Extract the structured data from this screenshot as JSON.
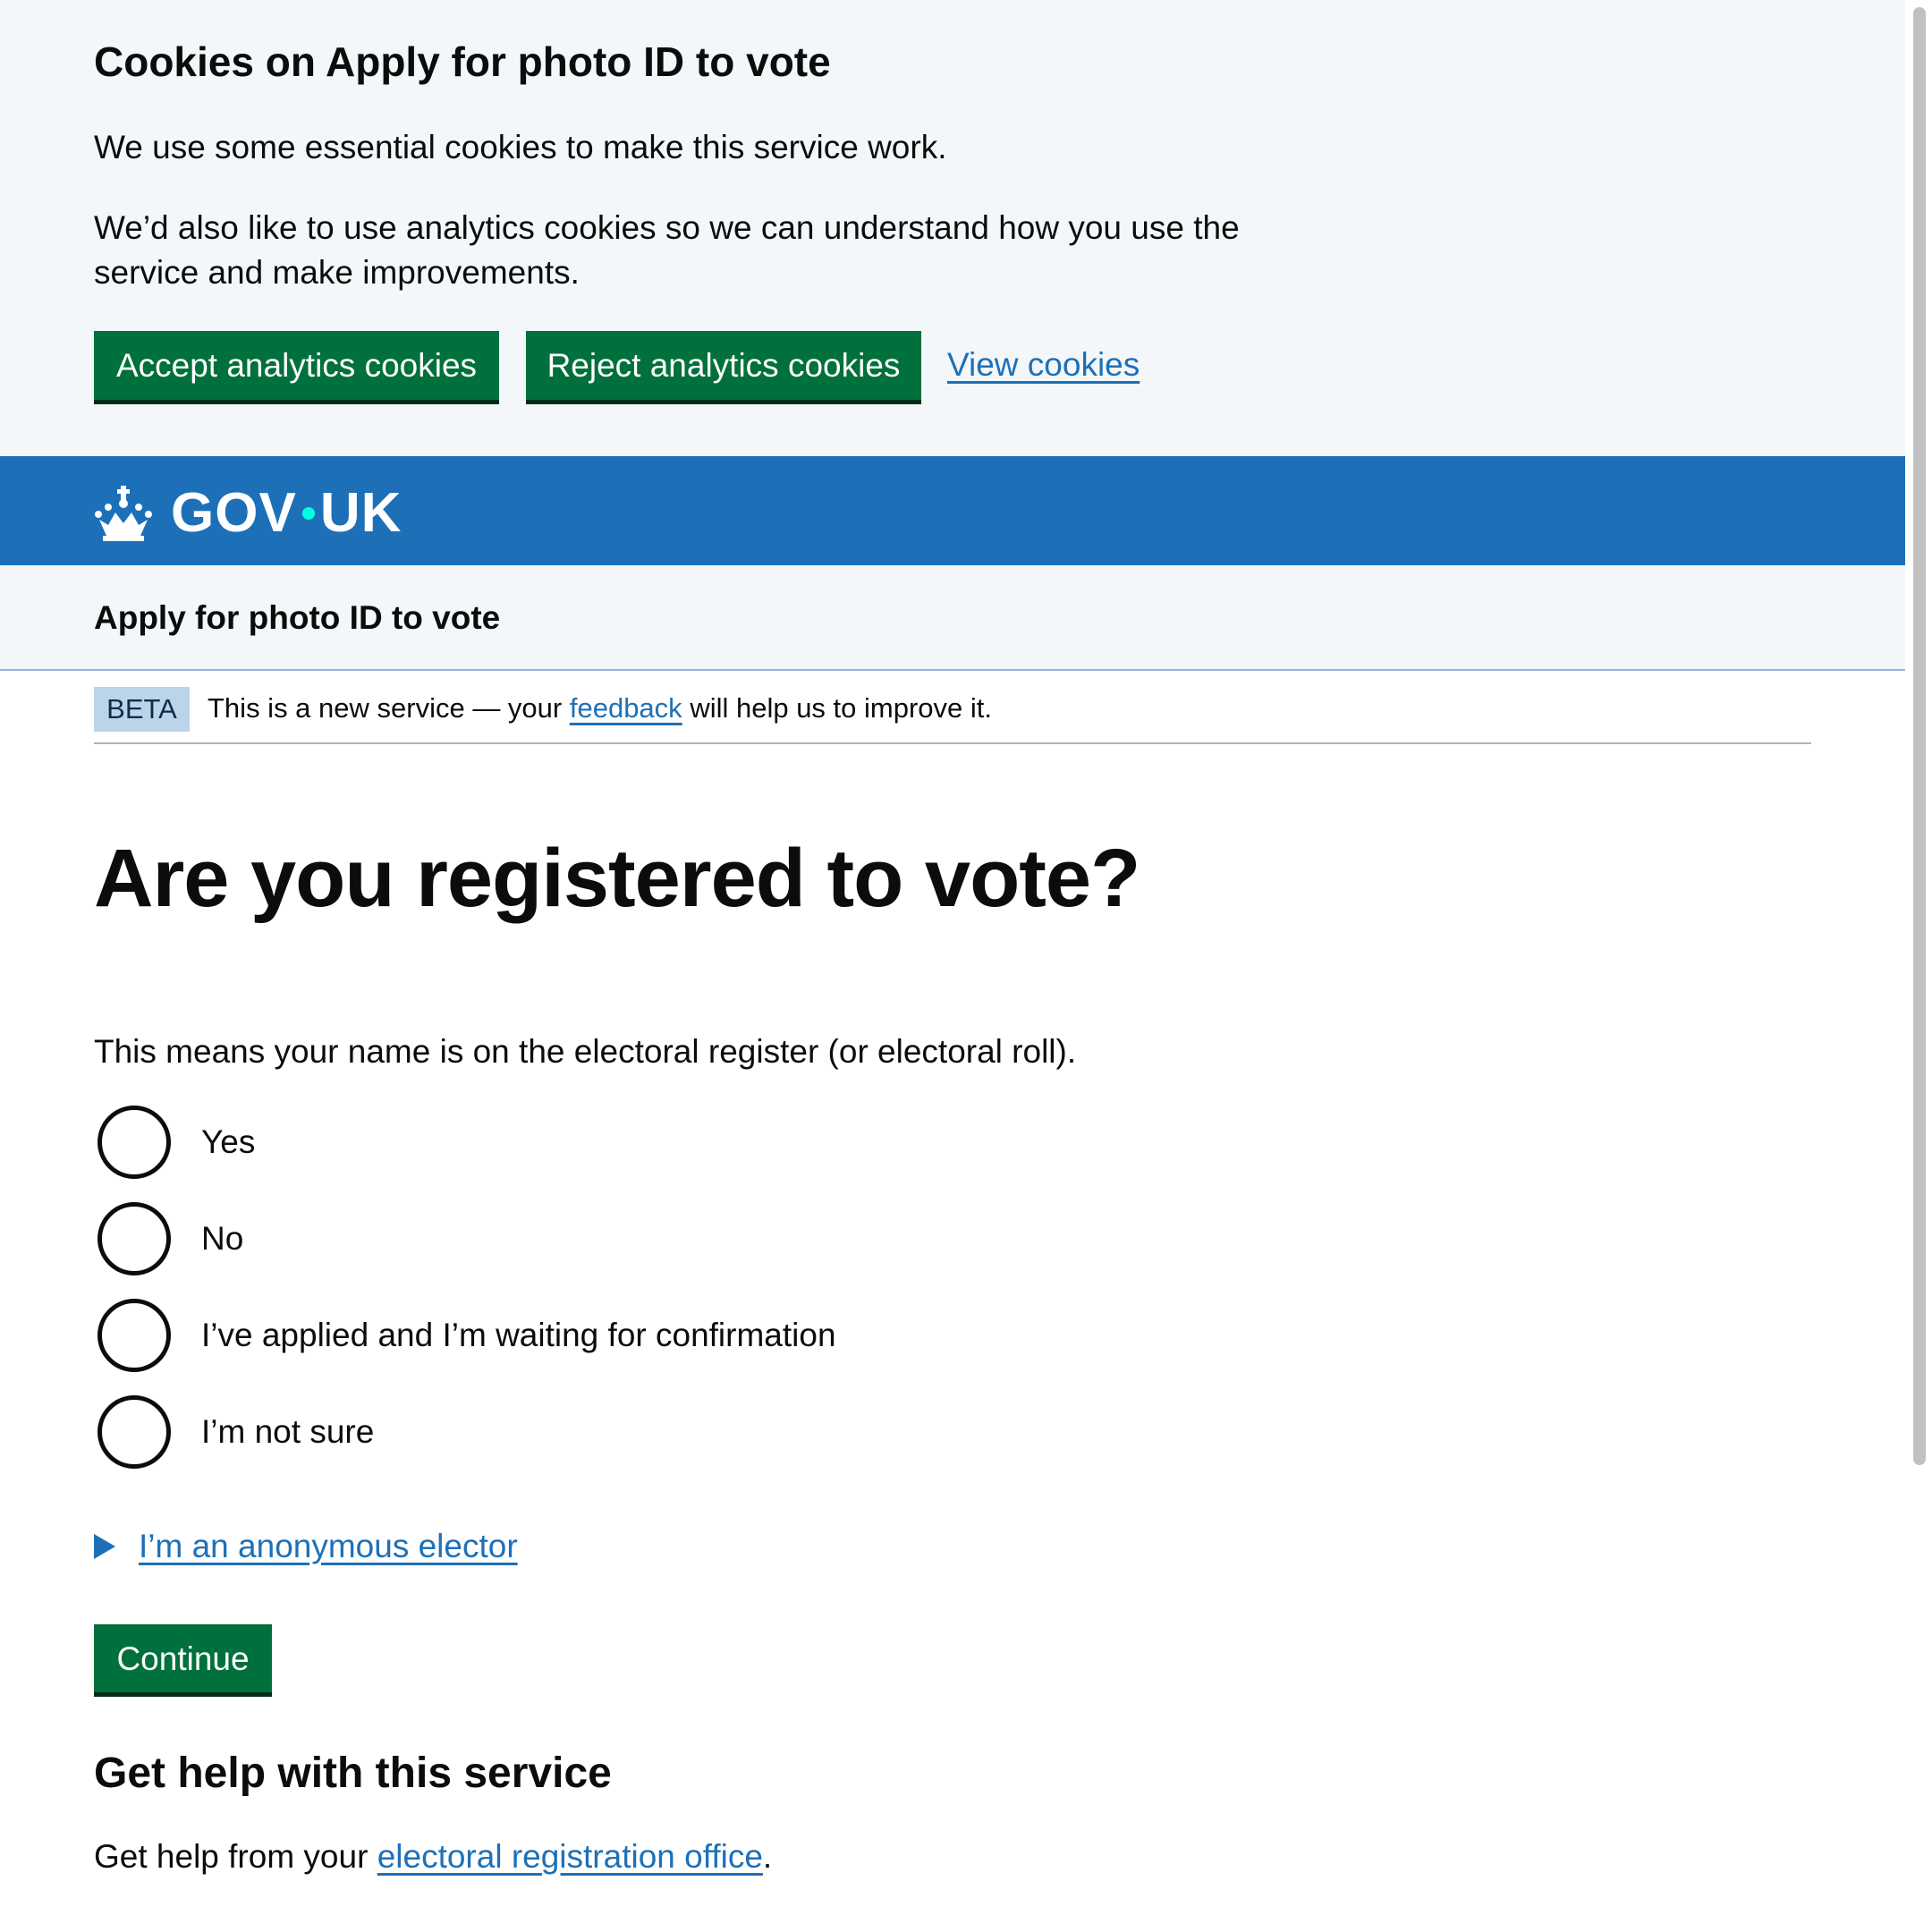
{
  "cookie_banner": {
    "title": "Cookies on Apply for photo ID to vote",
    "paragraph1": "We use some essential cookies to make this service work.",
    "paragraph2": "We’d also like to use analytics cookies so we can understand how you use the service and make improvements.",
    "accept_label": "Accept analytics cookies",
    "reject_label": "Reject analytics cookies",
    "view_label": "View cookies"
  },
  "header": {
    "logo_left": "GOV",
    "logo_right": "UK",
    "crown_icon": "crown-icon",
    "brand_color": "#1d70b8"
  },
  "service": {
    "name": "Apply for photo ID to vote"
  },
  "phase_banner": {
    "tag": "BETA",
    "text_before": "This is a new service — your",
    "link": "feedback",
    "text_after": "will help us to improve it."
  },
  "main": {
    "heading": "Are you registered to vote?",
    "hint": "This means your name is on the electoral register (or electoral roll).",
    "options": [
      {
        "label": "Yes"
      },
      {
        "label": "No"
      },
      {
        "label": "I’ve applied and I’m waiting for confirmation"
      },
      {
        "label": "I’m not sure"
      }
    ],
    "details_summary": "I’m an anonymous elector",
    "continue_label": "Continue"
  },
  "help": {
    "heading": "Get help with this service",
    "text_before": "Get help from your",
    "link": "electoral registration office",
    "text_after": "."
  },
  "colors": {
    "button_green": "#00703c",
    "link_blue": "#1d70b8"
  }
}
